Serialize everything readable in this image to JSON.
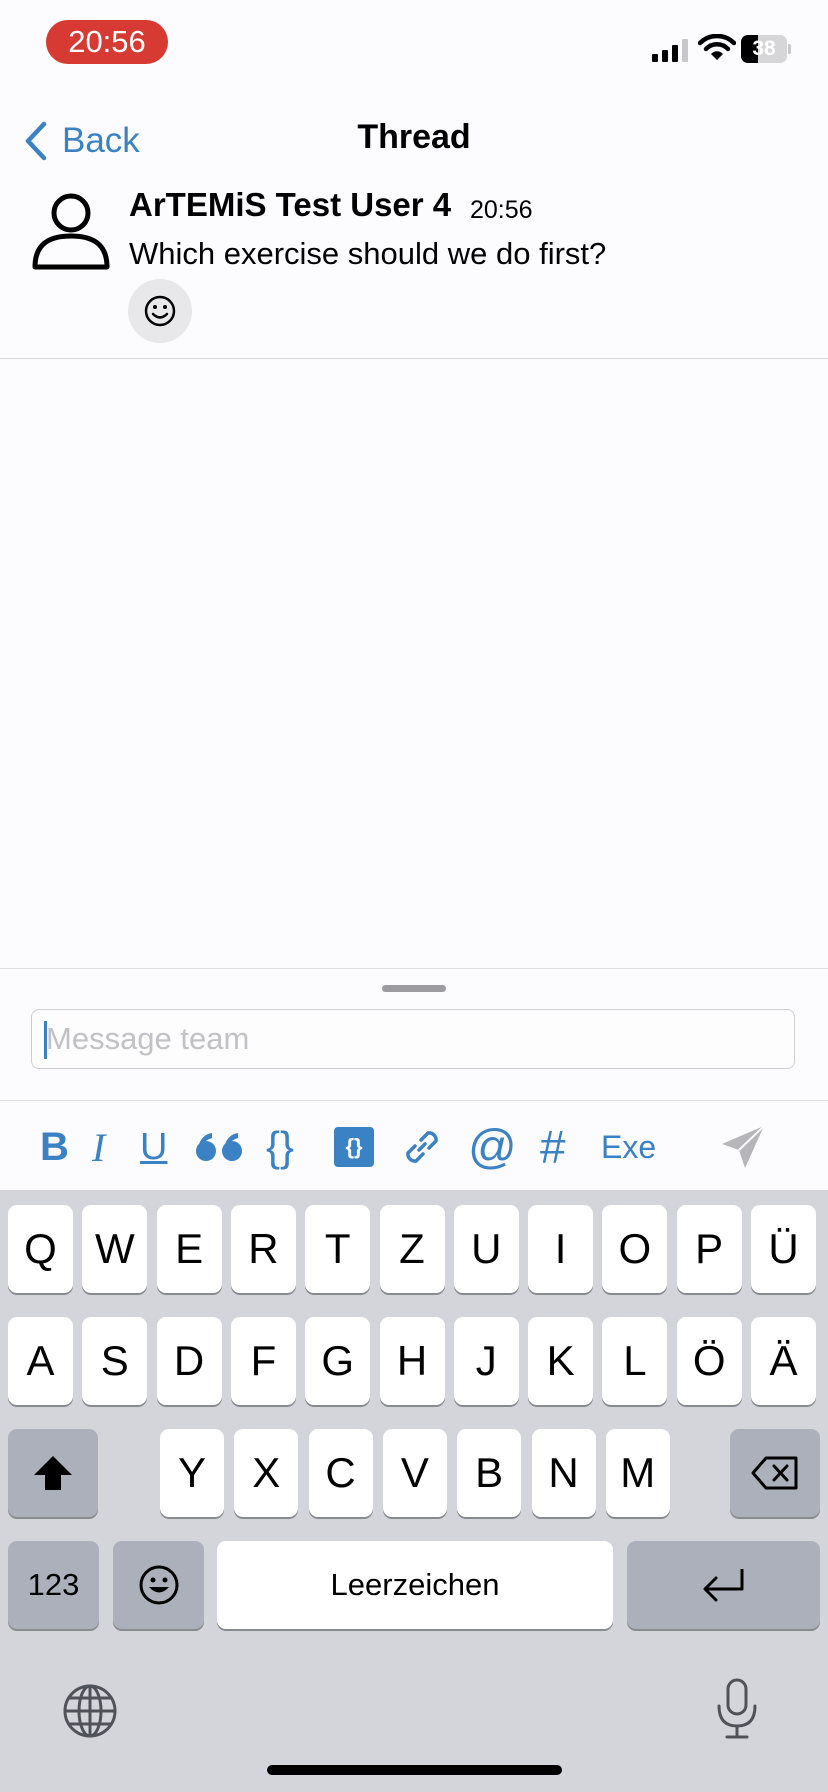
{
  "status_bar": {
    "time": "20:56",
    "battery": "38"
  },
  "nav": {
    "back_label": "Back",
    "title": "Thread"
  },
  "post": {
    "author": "ArTEMiS Test User 4",
    "time": "20:56",
    "text": "Which exercise should we do first?"
  },
  "composer": {
    "placeholder": "Message team"
  },
  "toolbar": {
    "bold": "B",
    "italic": "I",
    "underline": "U",
    "quote": "❝",
    "code": "{}",
    "code_block": "{}",
    "mention": "@",
    "channel": "#",
    "exercise": "Exe"
  },
  "keyboard": {
    "row1": [
      "Q",
      "W",
      "E",
      "R",
      "T",
      "Z",
      "U",
      "I",
      "O",
      "P",
      "Ü"
    ],
    "row2": [
      "A",
      "S",
      "D",
      "F",
      "G",
      "H",
      "J",
      "K",
      "L",
      "Ö",
      "Ä"
    ],
    "row3": [
      "Y",
      "X",
      "C",
      "V",
      "B",
      "N",
      "M"
    ],
    "numbers_label": "123",
    "space_label": "Leerzeichen"
  },
  "colors": {
    "accent": "#3b82c4",
    "time_pill": "#d63a32",
    "keyboard_bg": "#d3d5db"
  },
  "icons": {
    "back": "chevron-left-icon",
    "avatar": "person-icon",
    "reaction": "smiley-icon",
    "send": "paper-plane-icon",
    "link": "link-icon",
    "shift": "shift-icon",
    "delete": "backspace-icon",
    "emoji": "emoji-icon",
    "return": "return-icon",
    "globe": "globe-icon",
    "mic": "microphone-icon"
  }
}
